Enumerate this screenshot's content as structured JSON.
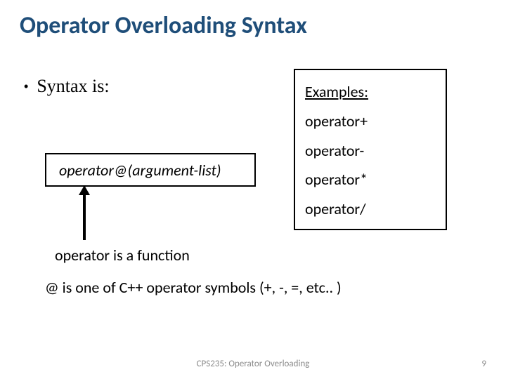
{
  "title": "Operator Overloading Syntax",
  "bullet": {
    "dot": "•",
    "text": "Syntax is:"
  },
  "syntax_box": "operator@(argument-list)",
  "examples": {
    "heading": "Examples:",
    "items": [
      "operator+",
      "operator-",
      "operator*",
      "operator/"
    ]
  },
  "arrow_label": "operator is a function",
  "explain": "@ is one of C++ operator symbols (+, -, =, etc.. )",
  "footer": "CPS235: Operator Overloading",
  "page_number": "9"
}
